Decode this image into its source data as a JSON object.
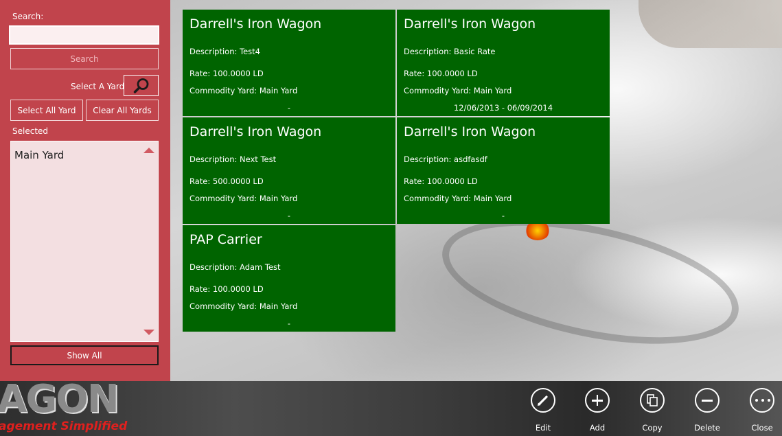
{
  "left_panel": {
    "search_label": "Search:",
    "search_value": "",
    "search_button": "Search",
    "select_yard_label": "Select A Yard",
    "select_all_button": "Select All Yard",
    "clear_all_button": "Clear All Yards",
    "selected_label": "Selected",
    "selected_items": [
      "Main Yard"
    ],
    "show_all_button": "Show All"
  },
  "cards": [
    {
      "title": "Darrell's Iron Wagon",
      "description": "Description: Test4",
      "rate": "Rate: 100.0000 LD",
      "yard": "Commodity Yard: Main Yard",
      "date": "-"
    },
    {
      "title": "Darrell's Iron Wagon",
      "description": "Description: Basic Rate",
      "rate": "Rate: 100.0000 LD",
      "yard": "Commodity Yard: Main Yard",
      "date": "12/06/2013 - 06/09/2014"
    },
    {
      "title": "Darrell's Iron Wagon",
      "description": "Description: Next Test",
      "rate": "Rate: 500.0000 LD",
      "yard": "Commodity Yard: Main Yard",
      "date": "-"
    },
    {
      "title": "Darrell's Iron Wagon",
      "description": "Description: asdfasdf",
      "rate": "Rate: 100.0000 LD",
      "yard": "Commodity Yard: Main Yard",
      "date": "-"
    },
    {
      "title": "PAP Carrier",
      "description": "Description: Adam Test",
      "rate": "Rate: 100.0000 LD",
      "yard": "Commodity Yard: Main Yard",
      "date": "-"
    }
  ],
  "brand": {
    "logo_text": "AGON",
    "tagline": "agement Simplified"
  },
  "app_bar": {
    "edit": "Edit",
    "add": "Add",
    "copy": "Copy",
    "delete": "Delete",
    "close": "Close"
  },
  "colors": {
    "panel": "#c1444c",
    "card": "#006400"
  }
}
